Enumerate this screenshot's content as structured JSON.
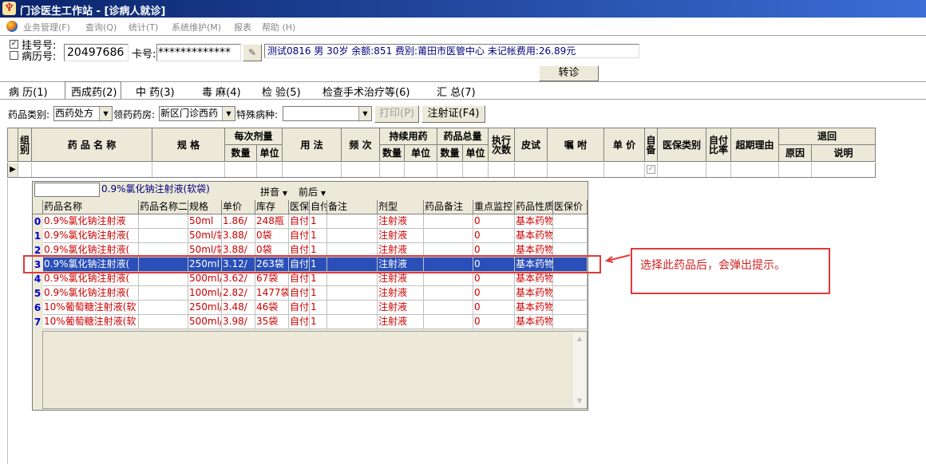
{
  "window": {
    "icon": "app-icon",
    "title": "门诊医生工作站 - [诊病人就诊]"
  },
  "menu": {
    "items": [
      "业务管理(F)",
      "查询(Q)",
      "统计(T)",
      "系统维护(M)",
      "报表",
      "帮助 (H)"
    ]
  },
  "patient": {
    "chk_reg_label": "挂号号:",
    "chk_rec_label": "病历号:",
    "chk_reg_checked": "✓",
    "record_no": "20497686",
    "card_label": "卡号:",
    "card_no": "*************",
    "info": "测试0816 男 30岁 余额:851 费别:莆田市医管中心 未记帐费用:26.89元",
    "transfer_button": "转诊"
  },
  "tabs": [
    "病 历(1)",
    "西成药(2)",
    "中 药(3)",
    "毒 麻(4)",
    "检 验(5)",
    "检查手术治疗等(6)",
    "汇 总(7)"
  ],
  "filters": {
    "category_label": "药品类别:",
    "category_value": "西药处方",
    "pharmacy_label": "领药药房:",
    "pharmacy_value": "新区门诊西药",
    "disease_label": "特殊病种:",
    "disease_value": "",
    "print_button": "打印(P)",
    "injection_button": "注射证(F4)"
  },
  "grid": {
    "headers": {
      "group": "组别",
      "drug_name": "药 品 名 称",
      "spec": "规 格",
      "per_dose": "每次剂量",
      "qty": "数量",
      "unit": "单位",
      "usage": "用 法",
      "freq": "频 次",
      "continuous": "持续用药",
      "total": "药品总量",
      "exec": "执行次数",
      "skin_test": "皮试",
      "instruction": "嘱 咐",
      "price": "单 价",
      "self": "自备",
      "insurance": "医保类别",
      "self_pay_rate": "自付比率",
      "over_reason": "超期理由",
      "return": "退回",
      "reason": "原因",
      "desc": "说明"
    },
    "self_checkbox_mark": "✓"
  },
  "popup": {
    "selected_name": "0.9%氯化钠注射液(软袋)",
    "mode": "拼音",
    "match": "前后",
    "columns": [
      "药品名称",
      "药品名称二",
      "规格",
      "单价",
      "库存",
      "医保",
      "自付",
      "备注",
      "剂型",
      "药品备注",
      "重点监控",
      "药品性质",
      "医保价"
    ],
    "rows": [
      {
        "idx": "0",
        "name": "0.9%氯化钠注射液",
        "name2": "",
        "spec": "50ml",
        "price": "1.86/",
        "stock": "248瓶",
        "ins": "自付",
        "self": "1",
        "remark": "",
        "form": "注射液",
        "dremark": "",
        "monitor": "0",
        "nature": "基本药物",
        "insprice": ""
      },
      {
        "idx": "1",
        "name": "0.9%氯化钠注射液(",
        "name2": "",
        "spec": "50ml/袋",
        "price": "3.88/",
        "stock": "0袋",
        "ins": "自付",
        "self": "1",
        "remark": "",
        "form": "注射液",
        "dremark": "",
        "monitor": "0",
        "nature": "基本药物",
        "insprice": ""
      },
      {
        "idx": "2",
        "name": "0.9%氯化钠注射液(",
        "name2": "",
        "spec": "50ml/袋",
        "price": "3.88/",
        "stock": "0袋",
        "ins": "自付",
        "self": "1",
        "remark": "",
        "form": "注射液",
        "dremark": "",
        "monitor": "0",
        "nature": "基本药物",
        "insprice": ""
      },
      {
        "idx": "3",
        "name": "0.9%氯化钠注射液(",
        "name2": "",
        "spec": "250ml",
        "price": "3.12/",
        "stock": "263袋",
        "ins": "自付",
        "self": "1",
        "remark": "",
        "form": "注射液",
        "dremark": "",
        "monitor": "0",
        "nature": "基本药物",
        "insprice": ""
      },
      {
        "idx": "4",
        "name": "0.9%氯化钠注射液(",
        "name2": "",
        "spec": "500ml/",
        "price": "3.62/",
        "stock": "67袋",
        "ins": "自付",
        "self": "1",
        "remark": "",
        "form": "注射液",
        "dremark": "",
        "monitor": "0",
        "nature": "基本药物",
        "insprice": ""
      },
      {
        "idx": "5",
        "name": "0.9%氯化钠注射液(",
        "name2": "",
        "spec": "100ml/",
        "price": "2.82/",
        "stock": "1477袋",
        "ins": "自付",
        "self": "1",
        "remark": "",
        "form": "注射液",
        "dremark": "",
        "monitor": "0",
        "nature": "基本药物",
        "insprice": ""
      },
      {
        "idx": "6",
        "name": "10%葡萄糖注射液(软",
        "name2": "",
        "spec": "250ml/",
        "price": "3.48/",
        "stock": "46袋",
        "ins": "自付",
        "self": "1",
        "remark": "",
        "form": "注射液",
        "dremark": "",
        "monitor": "0",
        "nature": "基本药物",
        "insprice": ""
      },
      {
        "idx": "7",
        "name": "10%葡萄糖注射液(软",
        "name2": "",
        "spec": "500ml/",
        "price": "3.98/",
        "stock": "35袋",
        "ins": "自付",
        "self": "1",
        "remark": "",
        "form": "注射液",
        "dremark": "",
        "monitor": "0",
        "nature": "基本药物",
        "insprice": ""
      }
    ],
    "selected_index": 3
  },
  "annotation": {
    "text": "选择此药品后，会弹出提示。",
    "color": "#e03a3a"
  }
}
